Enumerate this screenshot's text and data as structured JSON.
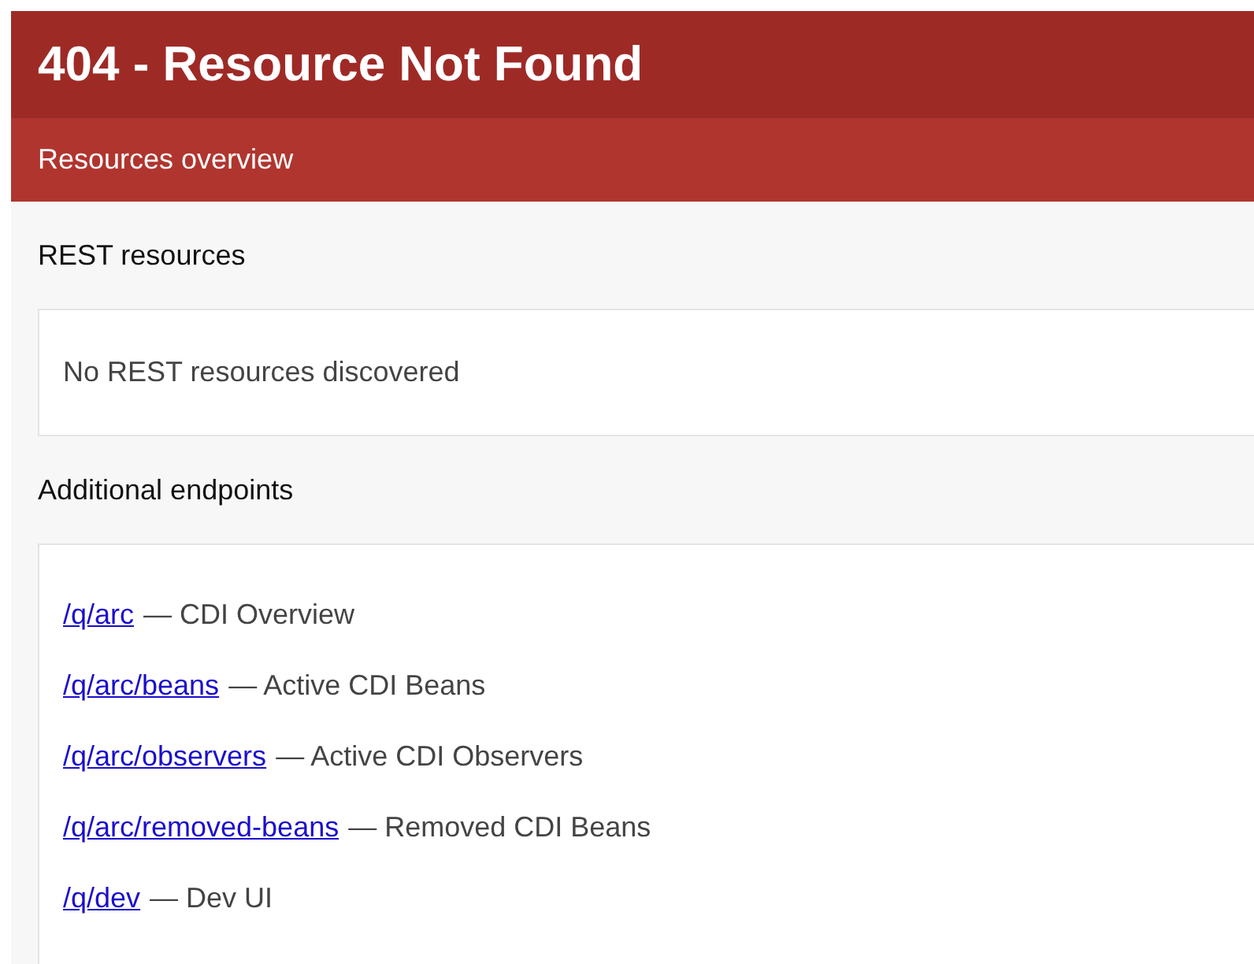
{
  "header": {
    "title": "404 - Resource Not Found",
    "subtitle": "Resources overview"
  },
  "sections": [
    {
      "heading": "REST resources",
      "kind": "message",
      "text": "No REST resources discovered"
    },
    {
      "heading": "Additional endpoints",
      "kind": "links",
      "items": [
        {
          "path": "/q/arc",
          "description": "— CDI Overview"
        },
        {
          "path": "/q/arc/beans",
          "description": "— Active CDI Beans"
        },
        {
          "path": "/q/arc/observers",
          "description": "— Active CDI Observers"
        },
        {
          "path": "/q/arc/removed-beans",
          "description": "— Removed CDI Beans"
        },
        {
          "path": "/q/dev",
          "description": "— Dev UI"
        }
      ]
    }
  ]
}
